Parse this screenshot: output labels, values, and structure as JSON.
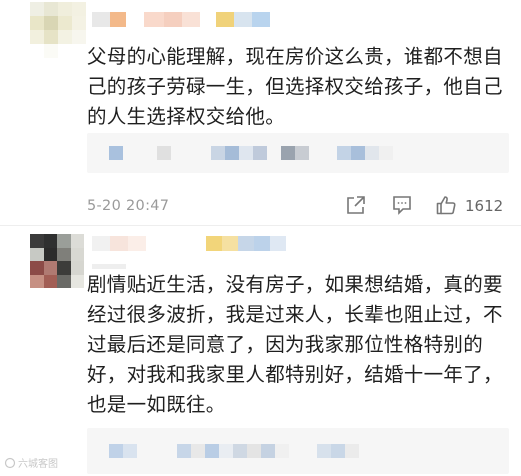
{
  "comments": [
    {
      "text": "父母的心能理解，现在房价这么贵，谁都不想自己的孩子劳碌一生，但选择权交给孩子，他自己的人生选择权交给他。",
      "time": "5-20 20:47",
      "likes": "1612",
      "icons": {
        "share": "share-icon",
        "comment": "comment-icon",
        "like": "thumbs-up-icon"
      }
    },
    {
      "text": "剧情贴近生活，没有房子，如果想结婚，真的要经过很多波折，我是过来人，长辈也阻止过，不过最后还是同意了，因为我家那位性格特别的好，对我和我家里人都特别好，结婚十一年了，也是一如既往。"
    }
  ],
  "watermark": {
    "text": "六城客图"
  },
  "colors": {
    "text": "#1f1f1f",
    "meta": "#9a9a9a",
    "reply_bg": "#f6f6f6"
  }
}
